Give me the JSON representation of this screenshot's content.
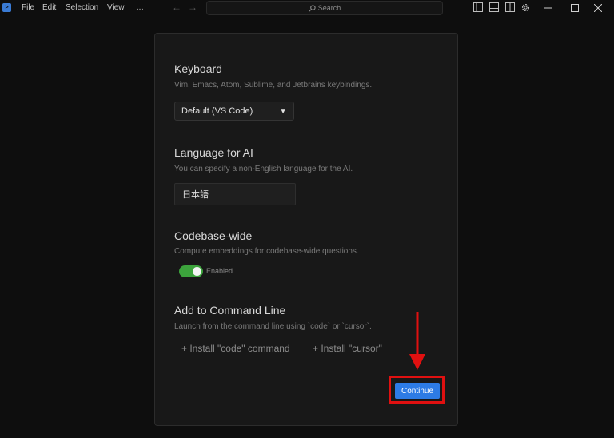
{
  "titlebar": {
    "menu": [
      "File",
      "Edit",
      "Selection",
      "View",
      "…"
    ],
    "search_placeholder": "Search"
  },
  "keyboard": {
    "title": "Keyboard",
    "description": "Vim, Emacs, Atom, Sublime, and Jetbrains keybindings.",
    "selected": "Default (VS Code)",
    "arrow": "▼"
  },
  "language": {
    "title": "Language for AI",
    "description": "You can specify a non-English language for the AI.",
    "value": "日本語"
  },
  "codebase": {
    "title": "Codebase-wide",
    "description": "Compute embeddings for codebase-wide questions.",
    "toggle_label": "Enabled",
    "toggle_on": true,
    "toggle_color": "#3ca33c"
  },
  "command_line": {
    "title": "Add to Command Line",
    "description": "Launch from the command line using `code` or `cursor`.",
    "install_code": "+ Install \"code\" command",
    "install_cursor": "+ Install \"cursor\""
  },
  "continue_label": "Continue",
  "colors": {
    "accent": "#2d7be5",
    "annotation": "#e01010"
  }
}
